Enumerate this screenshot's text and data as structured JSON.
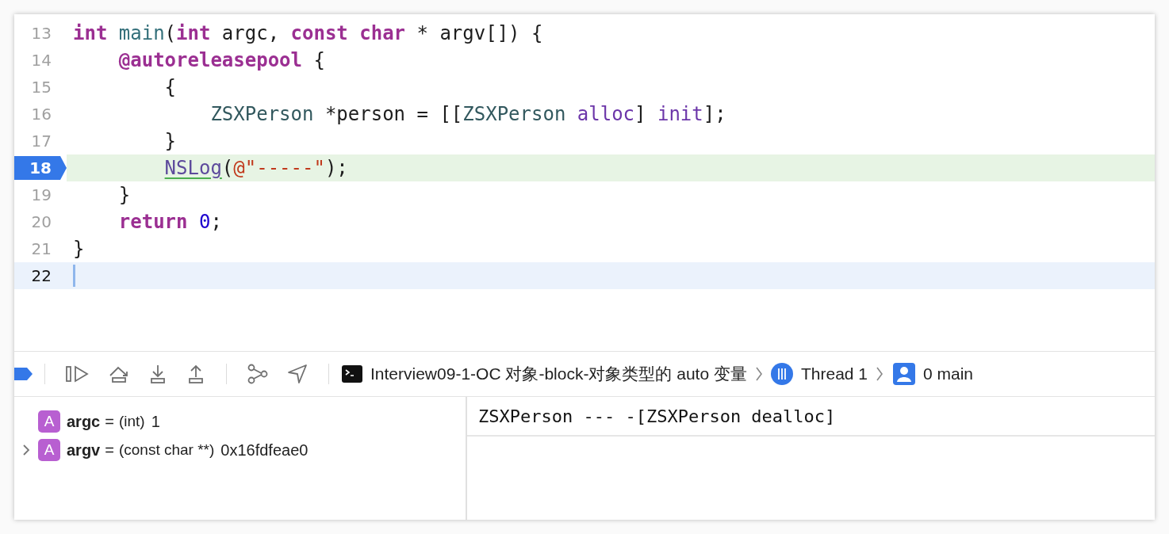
{
  "editor": {
    "lines": [
      {
        "number": "13",
        "kind": "normal",
        "tokens": [
          {
            "kind": "keyword",
            "text": "int "
          },
          {
            "kind": "function",
            "text": "main"
          },
          {
            "kind": "plain",
            "text": "("
          },
          {
            "kind": "keyword",
            "text": "int"
          },
          {
            "kind": "plain",
            "text": " argc, "
          },
          {
            "kind": "keyword",
            "text": "const char"
          },
          {
            "kind": "plain",
            "text": " * argv[]) {"
          }
        ]
      },
      {
        "number": "14",
        "kind": "normal",
        "tokens": [
          {
            "kind": "keyword",
            "text": "    @autoreleasepool"
          },
          {
            "kind": "plain",
            "text": " {"
          }
        ]
      },
      {
        "number": "15",
        "kind": "normal",
        "tokens": [
          {
            "kind": "plain",
            "text": "        {"
          }
        ]
      },
      {
        "number": "16",
        "kind": "normal",
        "tokens": [
          {
            "kind": "type",
            "text": "            ZSXPerson"
          },
          {
            "kind": "plain",
            "text": " *person = [["
          },
          {
            "kind": "type",
            "text": "ZSXPerson"
          },
          {
            "kind": "method",
            "text": " alloc"
          },
          {
            "kind": "plain",
            "text": "] "
          },
          {
            "kind": "method",
            "text": "init"
          },
          {
            "kind": "plain",
            "text": "];"
          }
        ]
      },
      {
        "number": "17",
        "kind": "normal",
        "tokens": [
          {
            "kind": "plain",
            "text": "        }"
          }
        ]
      },
      {
        "number": "18",
        "kind": "execution",
        "tokens": [
          {
            "kind": "call",
            "text": "        NSLog"
          },
          {
            "kind": "plain",
            "text": "("
          },
          {
            "kind": "string",
            "text": "@\"-----\""
          },
          {
            "kind": "plain",
            "text": ");"
          }
        ]
      },
      {
        "number": "19",
        "kind": "normal",
        "tokens": [
          {
            "kind": "plain",
            "text": "    }"
          }
        ]
      },
      {
        "number": "20",
        "kind": "normal",
        "tokens": [
          {
            "kind": "keyword",
            "text": "    return"
          },
          {
            "kind": "number",
            "text": " 0"
          },
          {
            "kind": "plain",
            "text": ";"
          }
        ]
      },
      {
        "number": "21",
        "kind": "normal",
        "tokens": [
          {
            "kind": "plain",
            "text": "}"
          }
        ]
      },
      {
        "number": "22",
        "kind": "cursor"
      }
    ]
  },
  "debug_bar": {
    "breakpoints_active": true,
    "process": "Interview09-1-OC 对象-block-对象类型的 auto 变量",
    "thread": "Thread 1",
    "frame": "0 main"
  },
  "variables": [
    {
      "badge": "A",
      "name": "argc",
      "operator": "=",
      "type": "(int)",
      "value": "1",
      "expandable": false
    },
    {
      "badge": "A",
      "name": "argv",
      "operator": "=",
      "type": "(const char **)",
      "value": "0x16fdfeae0",
      "expandable": true
    }
  ],
  "console": {
    "lines": [
      "ZSXPerson --- -[ZSXPerson dealloc]"
    ]
  }
}
